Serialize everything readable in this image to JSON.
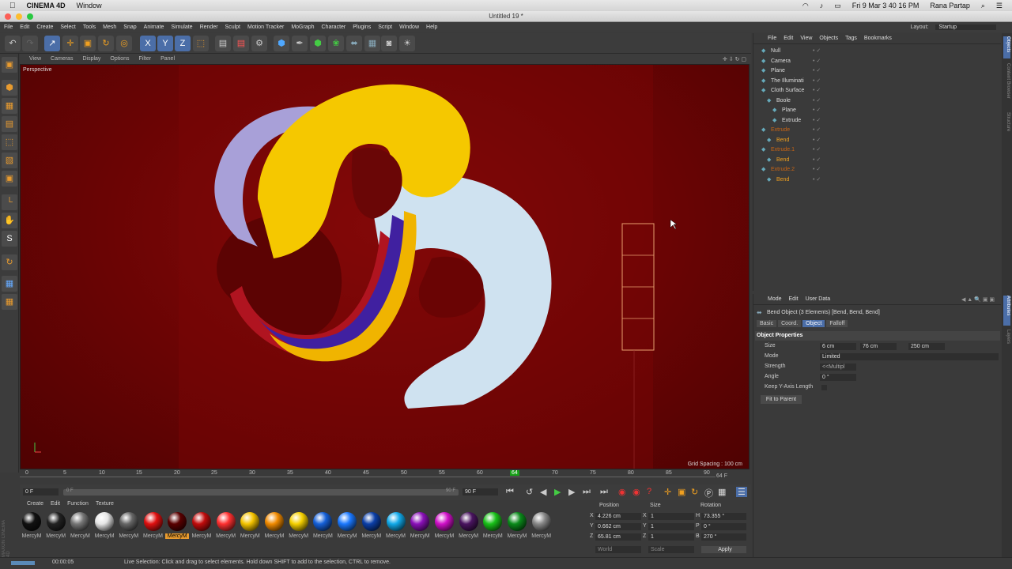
{
  "mac": {
    "app": "CINEMA 4D",
    "menu": "Window",
    "clock": "Fri 9 Mar 3 40 16 PM",
    "user": "Rana Partap"
  },
  "window": {
    "title": "Untitled 19 *",
    "layout_label": "Layout:",
    "layout_value": "Startup"
  },
  "menus": [
    "File",
    "Edit",
    "Create",
    "Select",
    "Tools",
    "Mesh",
    "Snap",
    "Animate",
    "Simulate",
    "Render",
    "Sculpt",
    "Motion Tracker",
    "MoGraph",
    "Character",
    "Plugins",
    "Script",
    "Window",
    "Help"
  ],
  "viewport_menu": [
    "View",
    "Cameras",
    "Display",
    "Options",
    "Filter",
    "Panel"
  ],
  "viewport": {
    "label": "Perspective",
    "grid_spacing": "Grid Spacing : 100 cm"
  },
  "timeline": {
    "ticks": [
      "0",
      "5",
      "10",
      "15",
      "20",
      "25",
      "30",
      "35",
      "40",
      "45",
      "50",
      "55",
      "60",
      "64",
      "70",
      "75",
      "80",
      "85",
      "90"
    ],
    "end_label": "64 F",
    "current_frame": 64,
    "start_field": "0 F",
    "range_start": "0 F",
    "range_end": "90 F",
    "end_field": "90 F"
  },
  "material_menu": [
    "Create",
    "Edit",
    "Function",
    "Texture"
  ],
  "materials": [
    {
      "label": "MercyM",
      "color": "#111"
    },
    {
      "label": "MercyM",
      "color": "#222"
    },
    {
      "label": "MercyM",
      "color": "#777"
    },
    {
      "label": "MercyM",
      "color": "#e6e6e6"
    },
    {
      "label": "MercyM",
      "color": "#666"
    },
    {
      "label": "MercyM",
      "color": "#e01010"
    },
    {
      "label": "MercyM",
      "color": "#5a0000",
      "selected": true
    },
    {
      "label": "MercyM",
      "color": "#c00c0c"
    },
    {
      "label": "MercyM",
      "color": "#ff3030"
    },
    {
      "label": "MercyM",
      "color": "#f5c400"
    },
    {
      "label": "MercyM",
      "color": "#f08a00"
    },
    {
      "label": "MercyM",
      "color": "#f5d000"
    },
    {
      "label": "MercyM",
      "color": "#1560d8"
    },
    {
      "label": "MercyM",
      "color": "#1a78ff"
    },
    {
      "label": "MercyM",
      "color": "#0b3fa8"
    },
    {
      "label": "MercyM",
      "color": "#10a8e8"
    },
    {
      "label": "MercyM",
      "color": "#8a10b8"
    },
    {
      "label": "MercyM",
      "color": "#d010c8"
    },
    {
      "label": "MercyM",
      "color": "#4a1460"
    },
    {
      "label": "MercyM",
      "color": "#18c018"
    },
    {
      "label": "MercyM",
      "color": "#0a8a1a"
    },
    {
      "label": "MercyM",
      "color": "#888"
    }
  ],
  "coords": {
    "headers": [
      "Position",
      "Size",
      "Rotation"
    ],
    "rows": [
      {
        "axis": "X",
        "pos": "4.226 cm",
        "size_axis": "X",
        "size": "1",
        "rot_axis": "H",
        "rot": "73.355 °"
      },
      {
        "axis": "Y",
        "pos": "0.662 cm",
        "size_axis": "Y",
        "size": "1",
        "rot_axis": "P",
        "rot": "0 °"
      },
      {
        "axis": "Z",
        "pos": "65.81 cm",
        "size_axis": "Z",
        "size": "1",
        "rot_axis": "B",
        "rot": "270 °"
      }
    ],
    "space": "World",
    "mode": "Scale",
    "apply": "Apply"
  },
  "status": {
    "time": "00:00:05",
    "text": "Live Selection: Click and drag to select elements. Hold down SHIFT to add to the selection, CTRL to remove."
  },
  "objmgr": {
    "menu": [
      "File",
      "Edit",
      "View",
      "Objects",
      "Tags",
      "Bookmarks"
    ],
    "objects": [
      {
        "name": "Null",
        "indent": 0,
        "color": "#ddd"
      },
      {
        "name": "Camera",
        "indent": 0,
        "color": "#ddd"
      },
      {
        "name": "Plane",
        "indent": 0,
        "color": "#ddd"
      },
      {
        "name": "The Illuminati",
        "indent": 0,
        "color": "#ddd"
      },
      {
        "name": "Cloth Surface",
        "indent": 0,
        "color": "#ddd"
      },
      {
        "name": "Boole",
        "indent": 1,
        "color": "#ddd"
      },
      {
        "name": "Plane",
        "indent": 2,
        "color": "#ddd"
      },
      {
        "name": "Extrude",
        "indent": 2,
        "color": "#ddd"
      },
      {
        "name": "Extrude",
        "indent": 0,
        "color": "#c86414"
      },
      {
        "name": "Bend",
        "indent": 1,
        "color": "#f0a020"
      },
      {
        "name": "Extrude.1",
        "indent": 0,
        "color": "#c86414"
      },
      {
        "name": "Bend",
        "indent": 1,
        "color": "#f0a020"
      },
      {
        "name": "Extrude.2",
        "indent": 0,
        "color": "#c86414"
      },
      {
        "name": "Bend",
        "indent": 1,
        "color": "#f0a020"
      }
    ]
  },
  "attr": {
    "menu": [
      "Mode",
      "Edit",
      "User Data"
    ],
    "object_title": "Bend Object (3 Elements) [Bend, Bend, Bend]",
    "tabs": [
      "Basic",
      "Coord.",
      "Object",
      "Falloff"
    ],
    "active_tab": "Object",
    "section": "Object Properties",
    "size_label": "Size",
    "size_values": [
      "6 cm",
      "76 cm",
      "250 cm"
    ],
    "mode_label": "Mode",
    "mode_value": "Limited",
    "strength_label": "Strength",
    "strength_value": "<<Multipl",
    "angle_label": "Angle",
    "angle_value": "0 °",
    "keep_label": "Keep Y-Axis Length",
    "fit_button": "Fit to Parent"
  },
  "right_strip": [
    "Objects",
    "Content Browser",
    "Structure",
    "Attributes",
    "Layers"
  ]
}
